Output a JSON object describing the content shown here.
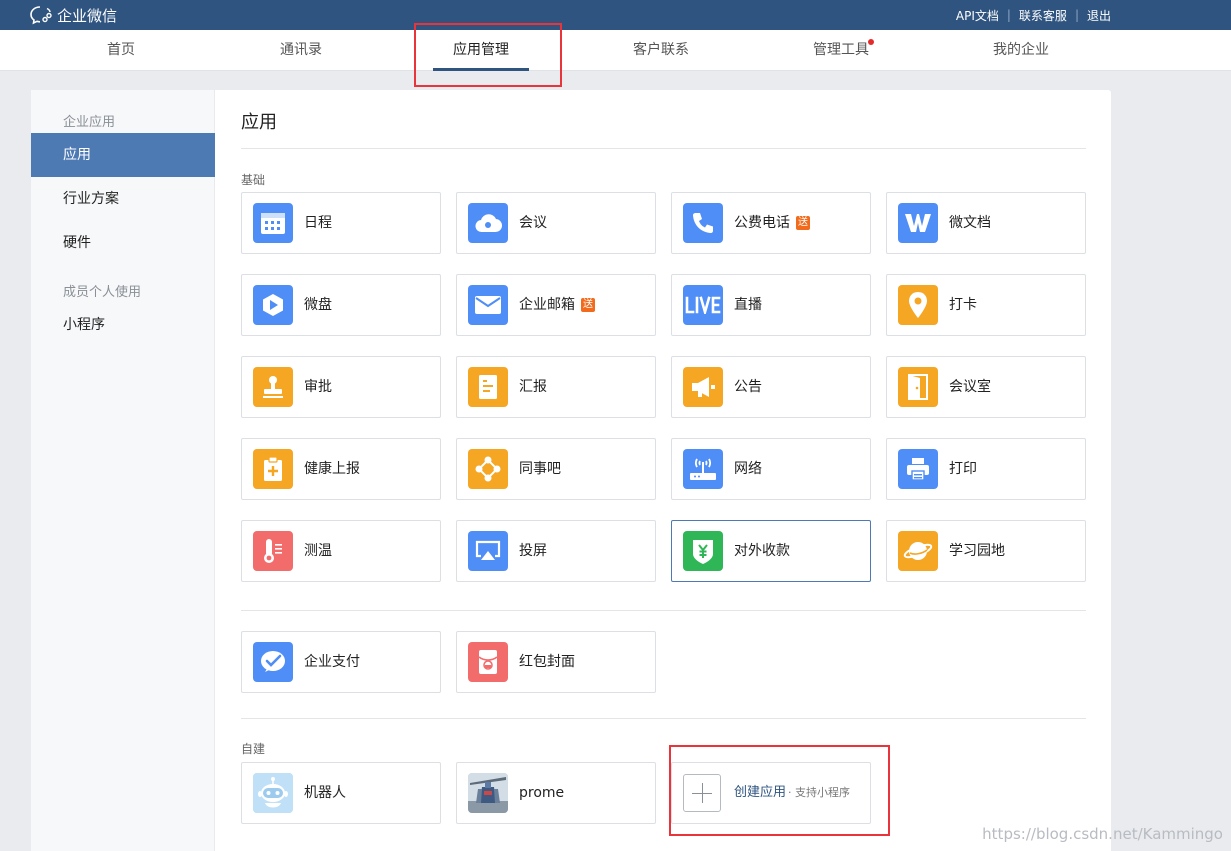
{
  "topbar": {
    "logo": "企业微信",
    "links": [
      "API文档",
      "联系客服",
      "退出"
    ],
    "separator": "|",
    "color": "#2f5480"
  },
  "nav": {
    "tabs": [
      {
        "label": "首页",
        "active": false
      },
      {
        "label": "通讯录",
        "active": false
      },
      {
        "label": "应用管理",
        "active": true
      },
      {
        "label": "客户联系",
        "active": false
      },
      {
        "label": "管理工具",
        "active": false,
        "notify_dot": true
      },
      {
        "label": "我的企业",
        "active": false
      }
    ]
  },
  "sidebar": {
    "group1": "企业应用",
    "item_apps": "应用",
    "item_industry": "行业方案",
    "item_hardware": "硬件",
    "group2": "成员个人使用",
    "item_miniprogram": "小程序"
  },
  "main": {
    "title": "应用",
    "section_basic": "基础",
    "section_custom": "自建",
    "badge": "送",
    "basic_apps": [
      {
        "label": "日程",
        "icon": "calendar-icon",
        "color": "#4f8ef7"
      },
      {
        "label": "会议",
        "icon": "cloud-icon",
        "color": "#4f8ef7"
      },
      {
        "label": "公费电话",
        "icon": "phone-icon",
        "color": "#4f8ef7",
        "badge": true
      },
      {
        "label": "微文档",
        "icon": "doc-w-icon",
        "color": "#4f8ef7"
      },
      {
        "label": "微盘",
        "icon": "drive-icon",
        "color": "#4f8ef7"
      },
      {
        "label": "企业邮箱",
        "icon": "mail-icon",
        "color": "#4f8ef7",
        "badge": true
      },
      {
        "label": "直播",
        "icon": "live-icon",
        "color": "#4f8ef7"
      },
      {
        "label": "打卡",
        "icon": "location-pin-icon",
        "color": "#f5a623"
      },
      {
        "label": "审批",
        "icon": "stamp-icon",
        "color": "#f5a623"
      },
      {
        "label": "汇报",
        "icon": "report-icon",
        "color": "#f5a623"
      },
      {
        "label": "公告",
        "icon": "megaphone-icon",
        "color": "#f5a623"
      },
      {
        "label": "会议室",
        "icon": "door-icon",
        "color": "#f5a623"
      },
      {
        "label": "健康上报",
        "icon": "health-icon",
        "color": "#f5a623"
      },
      {
        "label": "同事吧",
        "icon": "share-icon",
        "color": "#f5a623"
      },
      {
        "label": "网络",
        "icon": "wifi-router-icon",
        "color": "#4f8ef7"
      },
      {
        "label": "打印",
        "icon": "printer-icon",
        "color": "#4f8ef7"
      },
      {
        "label": "测温",
        "icon": "thermometer-icon",
        "color": "#f36c6c"
      },
      {
        "label": "投屏",
        "icon": "airplay-icon",
        "color": "#4f8ef7"
      },
      {
        "label": "对外收款",
        "icon": "yuan-shield-icon",
        "color": "#2fb657"
      },
      {
        "label": "学习园地",
        "icon": "planet-icon",
        "color": "#f5a623"
      }
    ],
    "pay_apps": [
      {
        "label": "企业支付",
        "icon": "pay-icon",
        "color": "#4f8ef7"
      },
      {
        "label": "红包封面",
        "icon": "red-envelope-icon",
        "color": "#f36c6c"
      }
    ],
    "custom_apps": [
      {
        "label": "机器人",
        "icon": "robot-icon"
      },
      {
        "label": "prome",
        "icon": "gundam-avatar-icon"
      }
    ],
    "create": {
      "label": "创建应用",
      "sub": "· 支持小程序"
    }
  },
  "watermark": "https://blog.csdn.net/Kammingo"
}
